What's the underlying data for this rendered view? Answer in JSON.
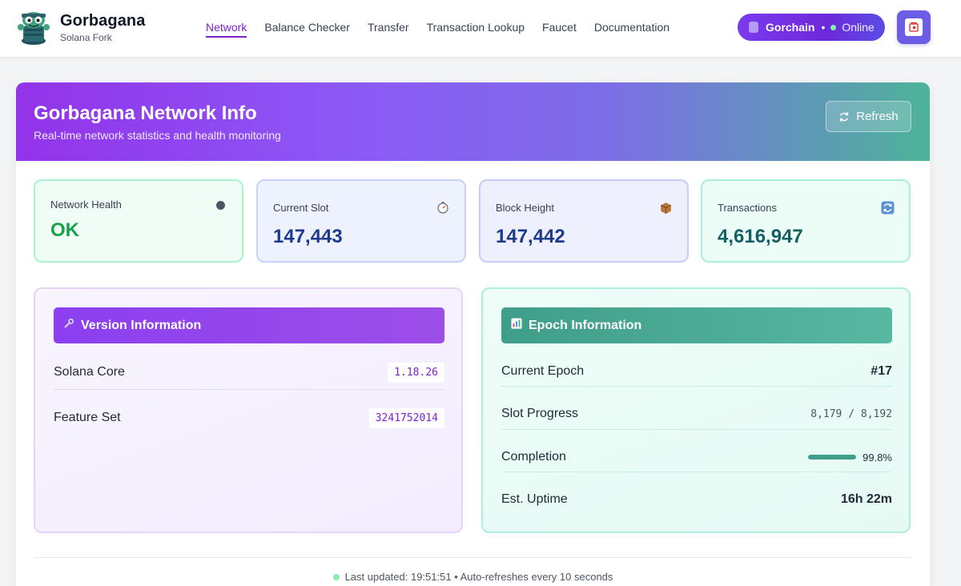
{
  "brand": {
    "name": "Gorbagana",
    "subtitle": "Solana Fork",
    "logo_icon": "cartoon-mascot-logo"
  },
  "nav": {
    "links": [
      {
        "label": "Network",
        "active": true
      },
      {
        "label": "Balance Checker",
        "active": false
      },
      {
        "label": "Transfer",
        "active": false
      },
      {
        "label": "Transaction Lookup",
        "active": false
      },
      {
        "label": "Faucet",
        "active": false
      },
      {
        "label": "Documentation",
        "active": false
      }
    ]
  },
  "chain": {
    "name": "Gorchain",
    "separator": "•",
    "status": "Online",
    "status_color": "#86efac"
  },
  "wallet": {
    "icon": "wallet-icon"
  },
  "hero": {
    "title": "Gorbagana Network Info",
    "subtitle": "Real-time network statistics and health monitoring",
    "refresh_label": "Refresh",
    "refresh_icon": "refresh-icon"
  },
  "stats": [
    {
      "label": "Network Health",
      "value": "OK",
      "icon": "status-dot-icon",
      "value_color": "#16a34a"
    },
    {
      "label": "Current Slot",
      "value": "147,443",
      "icon": "stopwatch-icon",
      "value_color": "#1e3a8a"
    },
    {
      "label": "Block Height",
      "value": "147,442",
      "icon": "package-icon",
      "value_color": "#1e3a8a"
    },
    {
      "label": "Transactions",
      "value": "4,616,947",
      "icon": "refresh-arrows-icon",
      "value_color": "#155e63"
    }
  ],
  "version": {
    "title": "Version Information",
    "icon": "wrench-icon",
    "rows": [
      {
        "label": "Solana Core",
        "value": "1.18.26"
      },
      {
        "label": "Feature Set",
        "value": "3241752014"
      }
    ]
  },
  "epoch": {
    "title": "Epoch Information",
    "icon": "bar-chart-icon",
    "current_epoch_label": "Current Epoch",
    "current_epoch": "#17",
    "slot_progress_label": "Slot Progress",
    "slot_progress": "8,179 / 8,192",
    "completion_label": "Completion",
    "completion": "99.8%",
    "completion_fraction": 0.998,
    "uptime_label": "Est. Uptime",
    "uptime": "16h 22m"
  },
  "footer": {
    "text": "Last updated: 19:51:51 • Auto-refreshes every 10 seconds",
    "dot_color": "#86efac"
  }
}
